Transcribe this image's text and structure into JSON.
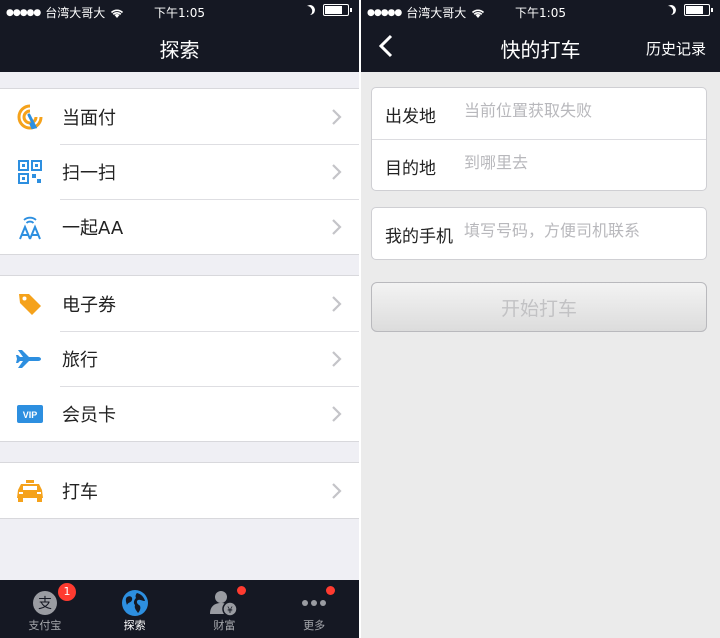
{
  "status": {
    "signal": "●●●●●",
    "carrier": "台湾大哥大",
    "time": "下午1:05"
  },
  "left": {
    "title": "探索",
    "groups": [
      [
        {
          "label": "当面付",
          "icon": "face-pay-icon"
        },
        {
          "label": "扫一扫",
          "icon": "qr-scan-icon"
        },
        {
          "label": "一起AA",
          "icon": "aa-split-icon"
        }
      ],
      [
        {
          "label": "电子券",
          "icon": "coupon-tag-icon"
        },
        {
          "label": "旅行",
          "icon": "airplane-icon"
        },
        {
          "label": "会员卡",
          "icon": "vip-card-icon"
        }
      ],
      [
        {
          "label": "打车",
          "icon": "taxi-icon"
        }
      ]
    ],
    "vip_text": "VIP",
    "tabs": [
      {
        "label": "支付宝",
        "badge": "1",
        "icon": "alipay-icon"
      },
      {
        "label": "探索",
        "icon": "globe-icon",
        "active": true
      },
      {
        "label": "财富",
        "icon": "wealth-icon",
        "dot": true
      },
      {
        "label": "更多",
        "icon": "more-dots-icon",
        "dot": true
      }
    ]
  },
  "right": {
    "title": "快的打车",
    "nav_right": "历史记录",
    "origin_label": "出发地",
    "origin_placeholder": "当前位置获取失败",
    "dest_label": "目的地",
    "dest_placeholder": "到哪里去",
    "phone_label": "我的手机",
    "phone_placeholder": "填写号码，方便司机联系",
    "start_button": "开始打车"
  },
  "colors": {
    "navbar": "#151823",
    "badge": "#ff3b30",
    "orange": "#f5a21b",
    "blue": "#2d8fe0"
  }
}
